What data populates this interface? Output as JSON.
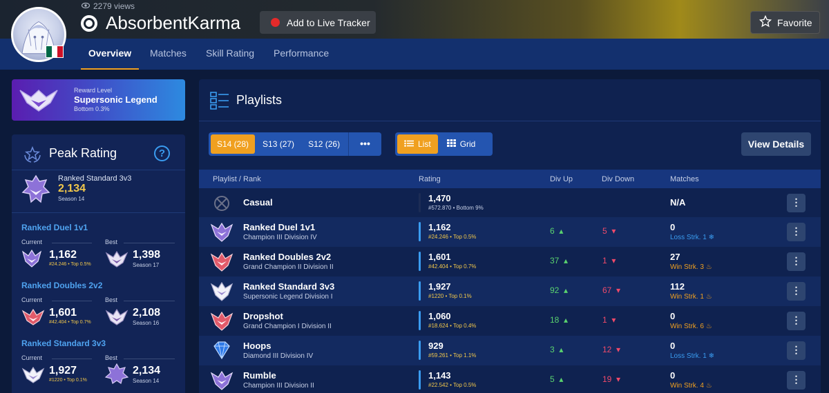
{
  "profile": {
    "views": "2279 views",
    "username": "AbsorbentKarma",
    "live_tracker_label": "Add to Live Tracker",
    "favorite_label": "Favorite",
    "flag_colors": [
      "#006847",
      "#ffffff",
      "#ce1126"
    ]
  },
  "nav": {
    "tabs": [
      "Overview",
      "Matches",
      "Skill Rating",
      "Performance"
    ],
    "active": "Overview"
  },
  "reward": {
    "label": "Reward Level",
    "value": "Supersonic Legend",
    "sub": "Bottom 0.3%"
  },
  "peak": {
    "title": "Peak Rating",
    "help_icon": "?",
    "best": {
      "playlist": "Ranked Standard 3v3",
      "rating": "2,134",
      "season": "Season 14"
    },
    "current_label": "Current",
    "best_label": "Best",
    "sections": [
      {
        "title": "Ranked Duel 1v1",
        "current": {
          "rating": "1,162",
          "sub": "#24.246 • Top 0.5%"
        },
        "best": {
          "rating": "1,398",
          "season": "Season 17"
        }
      },
      {
        "title": "Ranked Doubles 2v2",
        "current": {
          "rating": "1,601",
          "sub": "#42.404 • Top 0.7%"
        },
        "best": {
          "rating": "2,108",
          "season": "Season 16"
        }
      },
      {
        "title": "Ranked Standard 3v3",
        "current": {
          "rating": "1,927",
          "sub": "#1220 • Top 0.1%"
        },
        "best": {
          "rating": "2,134",
          "season": "Season 14"
        }
      }
    ]
  },
  "playlists": {
    "title": "Playlists",
    "seasons": [
      "S14 (28)",
      "S13 (27)",
      "S12 (26)"
    ],
    "active_season": "S14 (28)",
    "more_label": "•••",
    "view_list": "List",
    "view_grid": "Grid",
    "details_label": "View Details",
    "columns": {
      "playlist": "Playlist / Rank",
      "rating": "Rating",
      "divup": "Div Up",
      "divdown": "Div Down",
      "matches": "Matches"
    },
    "rows": [
      {
        "name": "Casual",
        "rank": "",
        "rating": "1,470",
        "rating_sub": "#572.870 • Bottom 9%",
        "divup": "",
        "divdown": "",
        "matches": "N/A",
        "streak": "",
        "streak_type": "none",
        "icon": "casual-icon"
      },
      {
        "name": "Ranked Duel 1v1",
        "rank": "Champion III Division IV",
        "rating": "1,162",
        "rating_sub": "#24.246 • Top 0.5%",
        "divup": "6",
        "divdown": "5",
        "matches": "0",
        "streak": "Loss Strk. 1",
        "streak_type": "loss",
        "icon": "champion-rank-icon"
      },
      {
        "name": "Ranked Doubles 2v2",
        "rank": "Grand Champion II Division II",
        "rating": "1,601",
        "rating_sub": "#42.404 • Top 0.7%",
        "divup": "37",
        "divdown": "1",
        "matches": "27",
        "streak": "Win Strk. 3",
        "streak_type": "win",
        "icon": "grand-champion-rank-icon"
      },
      {
        "name": "Ranked Standard 3v3",
        "rank": "Supersonic Legend Division I",
        "rating": "1,927",
        "rating_sub": "#1220 • Top 0.1%",
        "divup": "92",
        "divdown": "67",
        "matches": "112",
        "streak": "Win Strk. 1",
        "streak_type": "win",
        "icon": "supersonic-legend-rank-icon"
      },
      {
        "name": "Dropshot",
        "rank": "Grand Champion I Division II",
        "rating": "1,060",
        "rating_sub": "#18.624 • Top 0.4%",
        "divup": "18",
        "divdown": "1",
        "matches": "0",
        "streak": "Win Strk. 6",
        "streak_type": "win",
        "icon": "grand-champion-rank-icon"
      },
      {
        "name": "Hoops",
        "rank": "Diamond III Division IV",
        "rating": "929",
        "rating_sub": "#59.261 • Top 1.1%",
        "divup": "3",
        "divdown": "12",
        "matches": "0",
        "streak": "Loss Strk. 1",
        "streak_type": "loss",
        "icon": "diamond-rank-icon"
      },
      {
        "name": "Rumble",
        "rank": "Champion III Division II",
        "rating": "1,143",
        "rating_sub": "#22.542 • Top 0.5%",
        "divup": "5",
        "divdown": "19",
        "matches": "0",
        "streak": "Win Strk. 4",
        "streak_type": "win",
        "icon": "champion-rank-icon"
      }
    ]
  },
  "colors": {
    "accent": "#f0a020",
    "win": "#f0a020",
    "loss": "#3a9cf0",
    "divup": "#5ad36f",
    "divdown": "#f04a6a",
    "rating_highlight": "#f2c84b"
  }
}
